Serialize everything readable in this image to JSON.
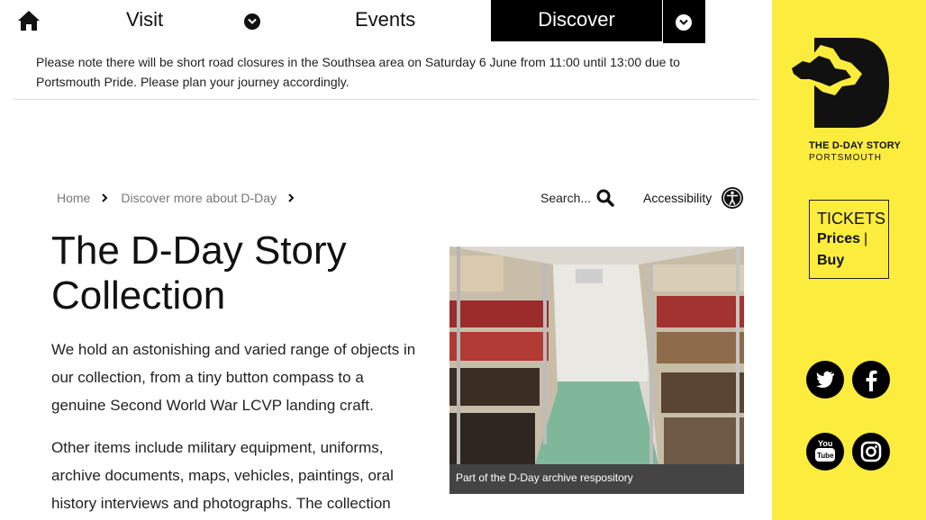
{
  "nav": {
    "home_icon": "home-icon",
    "visit": "Visit",
    "events": "Events",
    "discover": "Discover"
  },
  "notice": "Please note there will be short road closures in the Southsea area on Saturday 6 June from 11:00 until 13:00 due to Portsmouth Pride. Please plan your journey accordingly.",
  "breadcrumb": [
    "Home",
    "Discover more about D-Day"
  ],
  "search": {
    "label": "Search..."
  },
  "accessibility": {
    "label": "Accessibility"
  },
  "page": {
    "title": "The D-Day Story Collection",
    "para1": "We hold an astonishing and varied range of objects in our collection, from a tiny button compass to a genuine Second World War LCVP landing craft.",
    "para2": "Other items include military equipment, uniforms, archive documents, maps, vehicles, paintings, oral history interviews and photographs. The collection",
    "image_caption": "Part of the D-Day archive respository"
  },
  "sidebar": {
    "logo_title": "THE D-DAY STORY",
    "logo_sub": "PORTSMOUTH",
    "tickets_head": "TICKETS",
    "tickets_prices": "Prices",
    "tickets_sep": "|",
    "tickets_buy": "Buy",
    "social": [
      "twitter-icon",
      "facebook-icon",
      "youtube-icon",
      "instagram-icon"
    ]
  },
  "colors": {
    "sidebar_bg": "#fbec3e",
    "nav_active_bg": "#000000",
    "caption_bg": "#444444"
  }
}
